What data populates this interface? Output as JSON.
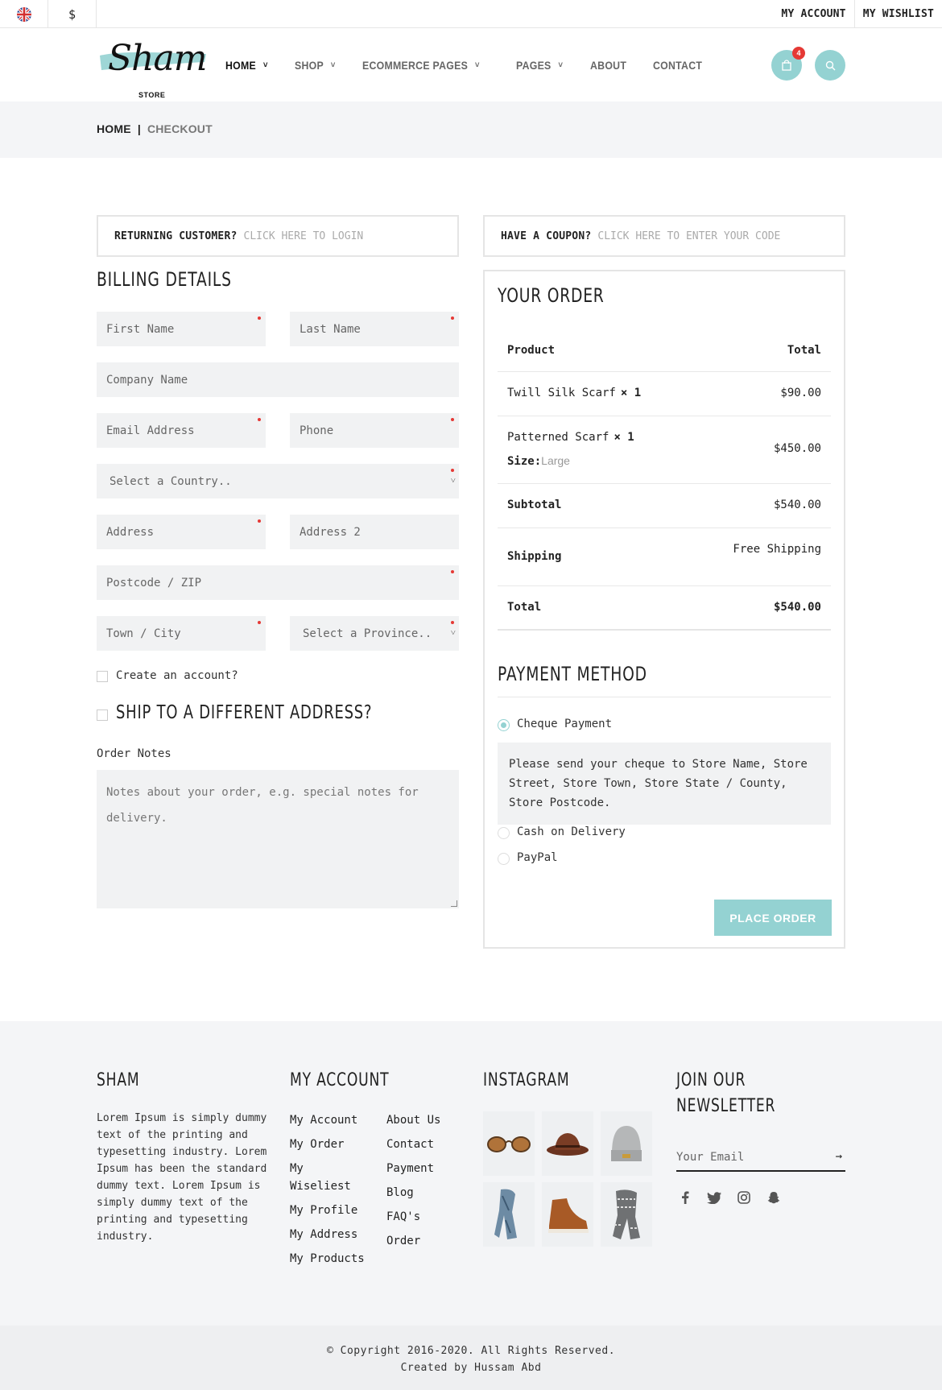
{
  "topbar": {
    "currency": "$",
    "my_account": "MY ACCOUNT",
    "my_wishlist": "MY WISHLIST"
  },
  "header": {
    "logo_text": "Sham",
    "logo_sub": "STORE",
    "nav": [
      {
        "label": "HOME"
      },
      {
        "label": "SHOP"
      },
      {
        "label": "ECOMMERCE PAGES"
      },
      {
        "label": "PAGES"
      },
      {
        "label": "ABOUT"
      },
      {
        "label": "CONTACT"
      }
    ],
    "cart_count": "4"
  },
  "breadcrumb": {
    "home": "HOME",
    "sep": "|",
    "current": "CHECKOUT"
  },
  "notices": {
    "returning_label": "RETURNING CUSTOMER?",
    "returning_link": "CLICK HERE TO LOGIN",
    "coupon_label": "HAVE A COUPON?",
    "coupon_link": "CLICK HERE TO ENTER YOUR CODE"
  },
  "billing": {
    "title": "BILLING DETAILS",
    "first_name": "First Name",
    "last_name": "Last Name",
    "company": "Company Name",
    "email": "Email Address",
    "phone": "Phone",
    "country": "Select a Country..",
    "address": "Address",
    "address2": "Address 2",
    "postcode": "Postcode / ZIP",
    "town": "Town / City",
    "province": "Select a Province..",
    "create_account": "Create an account?",
    "ship_different": "SHIP TO A DIFFERENT ADDRESS?",
    "order_notes_label": "Order Notes",
    "order_notes_placeholder": "Notes about your order, e.g. special notes for delivery."
  },
  "order": {
    "title": "YOUR ORDER",
    "col_product": "Product",
    "col_total": "Total",
    "items": [
      {
        "name": "Twill Silk Scarf",
        "qty": "× 1",
        "total": "$90.00"
      },
      {
        "name": "Patterned Scarf",
        "qty": "× 1",
        "size_label": "Size:",
        "size_value": "Large",
        "total": "$450.00"
      }
    ],
    "subtotal_label": "Subtotal",
    "subtotal": "$540.00",
    "shipping_label": "Shipping",
    "shipping": "Free Shipping",
    "total_label": "Total",
    "total": "$540.00"
  },
  "payment": {
    "title": "PAYMENT METHOD",
    "options": [
      {
        "label": "Cheque Payment",
        "selected": true
      },
      {
        "label": "Cash on Delivery",
        "selected": false
      },
      {
        "label": "PayPal",
        "selected": false
      }
    ],
    "cheque_desc": "Please send your cheque to Store Name, Store Street, Store Town, Store State / County, Store Postcode.",
    "place_order": "PLACE ORDER"
  },
  "footer": {
    "about_title": "SHAM",
    "about_text": "Lorem Ipsum is simply dummy text of the printing and typesetting industry. Lorem Ipsum has been the standard dummy text. Lorem Ipsum is simply dummy text of the printing and typesetting industry.",
    "account_title": "MY ACCOUNT",
    "account_links_a": [
      "My Account",
      "My Order",
      "My Wiseliest",
      "My Profile",
      "My Address",
      "My Products"
    ],
    "account_links_b": [
      "About Us",
      "Contact",
      "Payment",
      "Blog",
      "FAQ's",
      "Order"
    ],
    "instagram_title": "INSTAGRAM",
    "newsletter_title_1": "JOIN OUR",
    "newsletter_title_2": "NEWSLETTER",
    "newsletter_placeholder": "Your Email",
    "copyright": "© Copyright 2016-2020. All Rights Reserved.",
    "credit": "Created by Hussam Abd"
  }
}
